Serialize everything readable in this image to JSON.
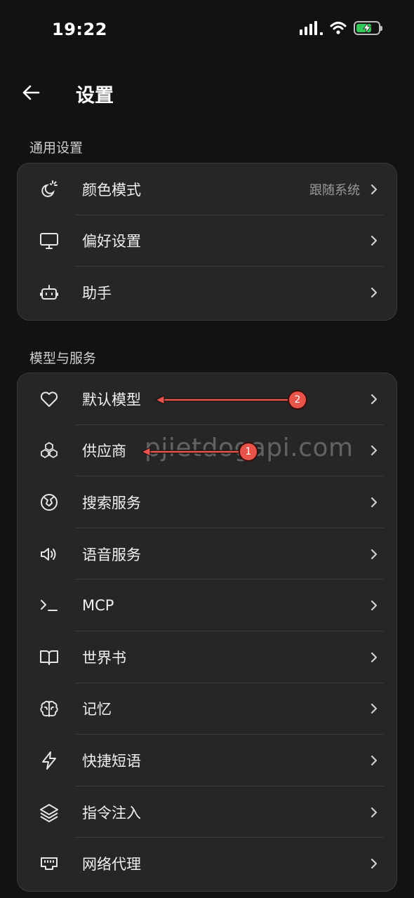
{
  "status_bar": {
    "time": "19:22"
  },
  "header": {
    "title": "设置"
  },
  "sections": [
    {
      "title": "通用设置",
      "items": [
        {
          "label": "颜色模式",
          "value": "跟随系统",
          "icon": "color-mode-icon"
        },
        {
          "label": "偏好设置",
          "value": "",
          "icon": "monitor-icon"
        },
        {
          "label": "助手",
          "value": "",
          "icon": "robot-icon"
        }
      ]
    },
    {
      "title": "模型与服务",
      "items": [
        {
          "label": "默认模型",
          "icon": "heart-icon"
        },
        {
          "label": "供应商",
          "icon": "boxes-icon"
        },
        {
          "label": "搜索服务",
          "icon": "globe-icon"
        },
        {
          "label": "语音服务",
          "icon": "speaker-icon"
        },
        {
          "label": "MCP",
          "icon": "terminal-icon"
        },
        {
          "label": "世界书",
          "icon": "book-icon"
        },
        {
          "label": "记忆",
          "icon": "brain-icon"
        },
        {
          "label": "快捷短语",
          "icon": "lightning-icon"
        },
        {
          "label": "指令注入",
          "icon": "layers-icon"
        },
        {
          "label": "网络代理",
          "icon": "ethernet-icon"
        }
      ]
    }
  ],
  "annotations": [
    {
      "number": "2",
      "color": "#e8534a"
    },
    {
      "number": "1",
      "color": "#e8534a"
    }
  ],
  "watermark": "pjietdogapi.com",
  "colors": {
    "background": "#121212",
    "card": "#262626",
    "accent_annotation": "#e8534a",
    "battery": "#33c759"
  }
}
